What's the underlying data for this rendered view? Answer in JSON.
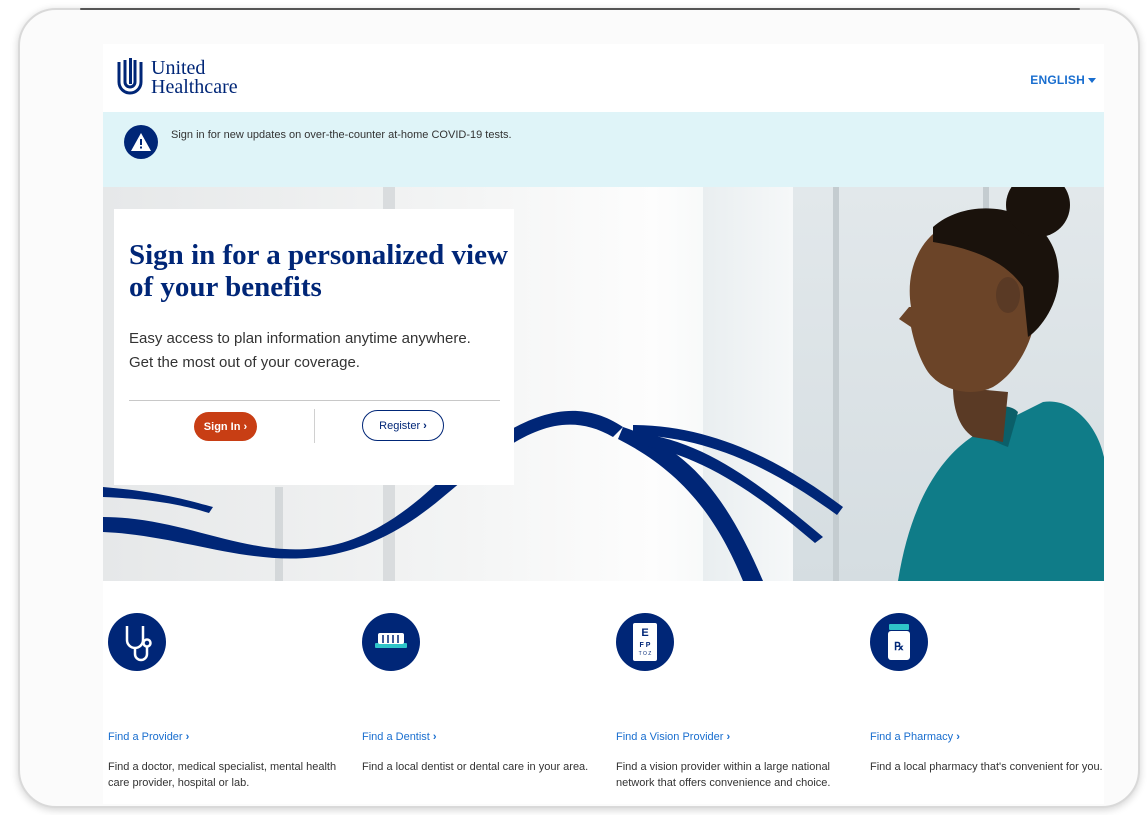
{
  "header": {
    "brand_line1": "United",
    "brand_line2": "Healthcare",
    "language": "ENGLISH"
  },
  "alert": {
    "text": "Sign in for new updates on over-the-counter at-home COVID-19 tests."
  },
  "hero": {
    "title": "Sign in for a personalized view of your benefits",
    "subtitle_line1": "Easy access to plan information anytime anywhere.",
    "subtitle_line2": "Get the most out of your coverage.",
    "signin_label": "Sign In",
    "register_label": "Register"
  },
  "services": [
    {
      "link": "Find a Provider",
      "desc": "Find a doctor, medical specialist, mental health care provider, hospital or lab.",
      "icon": "stethoscope-icon"
    },
    {
      "link": "Find a Dentist",
      "desc": "Find a local dentist or dental care in your area.",
      "icon": "toothbrush-icon"
    },
    {
      "link": "Find a Vision Provider",
      "desc": "Find a vision provider within a large national network that offers convenience and choice.",
      "icon": "eye-chart-icon"
    },
    {
      "link": "Find a Pharmacy",
      "desc": "Find a local pharmacy that's convenient for you.",
      "icon": "pill-bottle-icon"
    }
  ],
  "colors": {
    "brand_navy": "#002677",
    "link_blue": "#196ecf",
    "signin_orange": "#c83e14",
    "alert_bg": "#dff4f8"
  }
}
